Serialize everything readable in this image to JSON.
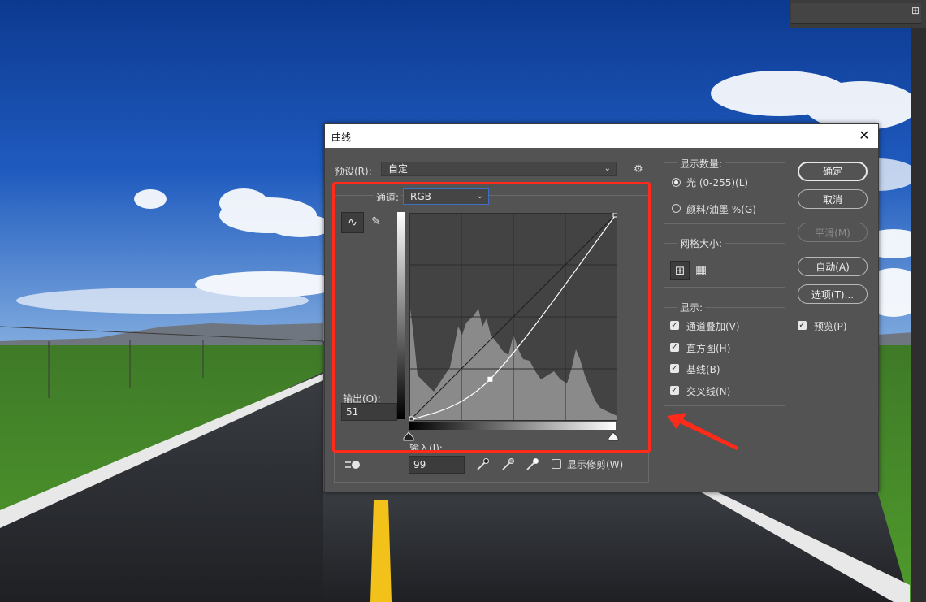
{
  "dialog": {
    "title": "曲线",
    "close_glyph": "✕",
    "preset_label": "预设(R):",
    "preset_value": "自定",
    "channel_label": "通道:",
    "channel_value": "RGB",
    "output_label": "输出(O):",
    "output_value": "51",
    "input_label": "输入(I):",
    "input_value": "99",
    "show_clipping_label": "显示修剪(W)",
    "gear_glyph": "⚙",
    "chevron_glyph": "⌄"
  },
  "display_amount": {
    "title": "显示数量:",
    "options": [
      {
        "label": "光 (0-255)(L)",
        "selected": true
      },
      {
        "label": "颜料/油墨 %(G)",
        "selected": false
      }
    ]
  },
  "grid_size": {
    "title": "网格大小:",
    "selected": "simple"
  },
  "show": {
    "title": "显示:",
    "options": [
      {
        "label": "通道叠加(V)",
        "checked": true
      },
      {
        "label": "直方图(H)",
        "checked": true
      },
      {
        "label": "基线(B)",
        "checked": true
      },
      {
        "label": "交叉线(N)",
        "checked": true
      }
    ]
  },
  "buttons": {
    "ok": "确定",
    "cancel": "取消",
    "smooth": "平滑(M)",
    "auto": "自动(A)",
    "options": "选项(T)..."
  },
  "preview": {
    "label": "预览(P)",
    "checked": true
  },
  "curve": {
    "points": [
      [
        0,
        0
      ],
      [
        99,
        51
      ],
      [
        255,
        255
      ]
    ],
    "point_selected": 1
  },
  "colors": {
    "highlight_box": "#ff2a1a",
    "arrow": "#ff2a1a",
    "dialog_bg": "#535353",
    "graph_bg": "#434343"
  },
  "icons": {
    "curve_tool": "curve-point-icon",
    "pencil_tool": "pencil-icon",
    "grid_simple": "grid-4-icon",
    "grid_detailed": "grid-10-icon",
    "on_image_adjust": "hand-target-icon",
    "black_point": "eyedropper-black-icon",
    "gray_point": "eyedropper-gray-icon",
    "white_point": "eyedropper-white-icon",
    "panel": "panel-menu-icon"
  }
}
